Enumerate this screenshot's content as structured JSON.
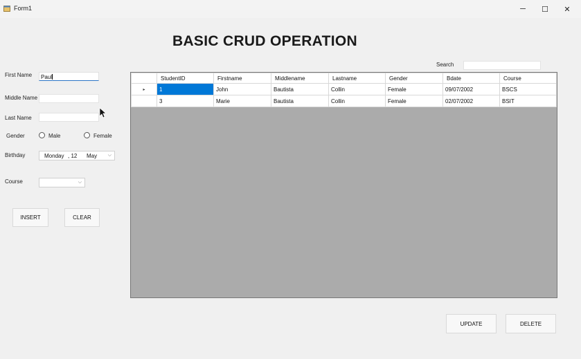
{
  "window": {
    "title": "Form1"
  },
  "heading": "BASIC CRUD OPERATION",
  "search": {
    "label": "Search",
    "value": ""
  },
  "form": {
    "first_name_label": "First Name",
    "first_name_value": "Paul",
    "middle_name_label": "Middle Name",
    "middle_name_value": "",
    "last_name_label": "Last Name",
    "last_name_value": "",
    "gender_label": "Gender",
    "gender_options": [
      "Male",
      "Female"
    ],
    "birthday_label": "Birthday",
    "birthday_day": "Monday",
    "birthday_date": ", 12",
    "birthday_month": "May",
    "course_label": "Course",
    "course_value": ""
  },
  "buttons": {
    "insert": "INSERT",
    "clear": "CLEAR",
    "update": "UPDATE",
    "delete": "DELETE"
  },
  "table": {
    "columns": [
      "StudentID",
      "Firstname",
      "Middlename",
      "Lastname",
      "Gender",
      "Bdate",
      "Course"
    ],
    "rows": [
      [
        "1",
        "John",
        "Bautista",
        "Collin",
        "Female",
        "09/07/2002",
        "BSCS"
      ],
      [
        "3",
        "Marie",
        "Bautista",
        "Collin",
        "Female",
        "02/07/2002",
        "BSIT"
      ]
    ],
    "current_row_marker": "▸"
  },
  "icons": {
    "minimize": "─",
    "maximize": "☐",
    "close": "✕"
  },
  "colors": {
    "selection": "#0078d7",
    "grid_background": "#ababab",
    "focus_underline": "#2a74c6"
  }
}
